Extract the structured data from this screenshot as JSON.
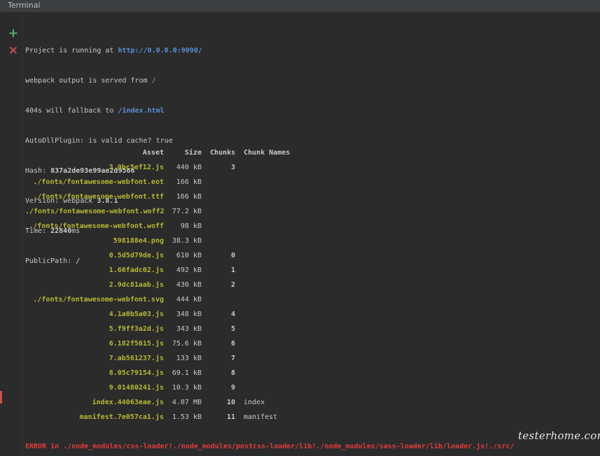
{
  "window": {
    "title": "Terminal"
  },
  "toolbar": {
    "add_icon": "+",
    "close_icon": "✕"
  },
  "console": {
    "lines": [
      {
        "prefix": "Project is running at ",
        "value": "http://0.0.0.0:9090/"
      },
      {
        "prefix": "webpack output is served from ",
        "value": "/"
      },
      {
        "prefix": "404s will fallback to ",
        "value": "/index.html"
      },
      {
        "prefix": "AutoDllPlugin: is valid cache? true",
        "value": ""
      },
      {
        "prefix": "Hash: ",
        "value": "837a2de93e99ae2d9566"
      },
      {
        "prefix": "Version: webpack ",
        "value": "3.8.1"
      },
      {
        "prefix": "Time: ",
        "value": "22840",
        "suffix": "ms"
      },
      {
        "prefix": "PublicPath: ",
        "value": "/"
      }
    ]
  },
  "assets": {
    "headers": {
      "asset": "Asset",
      "size": "Size",
      "chunks": "Chunks",
      "chunk_names": "Chunk Names"
    },
    "rows": [
      {
        "asset": "3.9bc5ef12.js",
        "size": "440 kB",
        "chunks": "3",
        "name": ""
      },
      {
        "asset": "./fonts/fontawesome-webfont.eot",
        "size": "166 kB",
        "chunks": "",
        "name": ""
      },
      {
        "asset": "./fonts/fontawesome-webfont.ttf",
        "size": "166 kB",
        "chunks": "",
        "name": ""
      },
      {
        "asset": "./fonts/fontawesome-webfont.woff2",
        "size": "77.2 kB",
        "chunks": "",
        "name": ""
      },
      {
        "asset": "./fonts/fontawesome-webfont.woff",
        "size": "98 kB",
        "chunks": "",
        "name": ""
      },
      {
        "asset": "598188e4.png",
        "size": "38.3 kB",
        "chunks": "",
        "name": ""
      },
      {
        "asset": "0.5d5d79de.js",
        "size": "610 kB",
        "chunks": "0",
        "name": ""
      },
      {
        "asset": "1.66fadc02.js",
        "size": "492 kB",
        "chunks": "1",
        "name": ""
      },
      {
        "asset": "2.9dc81aab.js",
        "size": "430 kB",
        "chunks": "2",
        "name": ""
      },
      {
        "asset": "./fonts/fontawesome-webfont.svg",
        "size": "444 kB",
        "chunks": "",
        "name": ""
      },
      {
        "asset": "4.1a0b5a03.js",
        "size": "348 kB",
        "chunks": "4",
        "name": ""
      },
      {
        "asset": "5.f9ff3a2d.js",
        "size": "343 kB",
        "chunks": "5",
        "name": ""
      },
      {
        "asset": "6.182f5615.js",
        "size": "75.6 kB",
        "chunks": "6",
        "name": ""
      },
      {
        "asset": "7.ab561237.js",
        "size": "133 kB",
        "chunks": "7",
        "name": ""
      },
      {
        "asset": "8.05c79154.js",
        "size": "69.1 kB",
        "chunks": "8",
        "name": ""
      },
      {
        "asset": "9.01480241.js",
        "size": "10.3 kB",
        "chunks": "9",
        "name": ""
      },
      {
        "asset": "index.44063eae.js",
        "size": "4.07 MB",
        "chunks": "10",
        "name": "index"
      },
      {
        "asset": "manifest.7e057ca1.js",
        "size": "1.53 kB",
        "chunks": "11",
        "name": "manifest"
      }
    ]
  },
  "error": {
    "text": "ERROR in ./node_modules/css-loader!./node_modules/postcss-loader/lib!./node_modules/sass-loader/lib/loader.js!./src/"
  },
  "watermark": {
    "text": "testerhome.com"
  },
  "colors": {
    "background": "#2b2b2b",
    "asset": "#b5b835",
    "link": "#5a8fd6",
    "error": "#e03c3c"
  }
}
